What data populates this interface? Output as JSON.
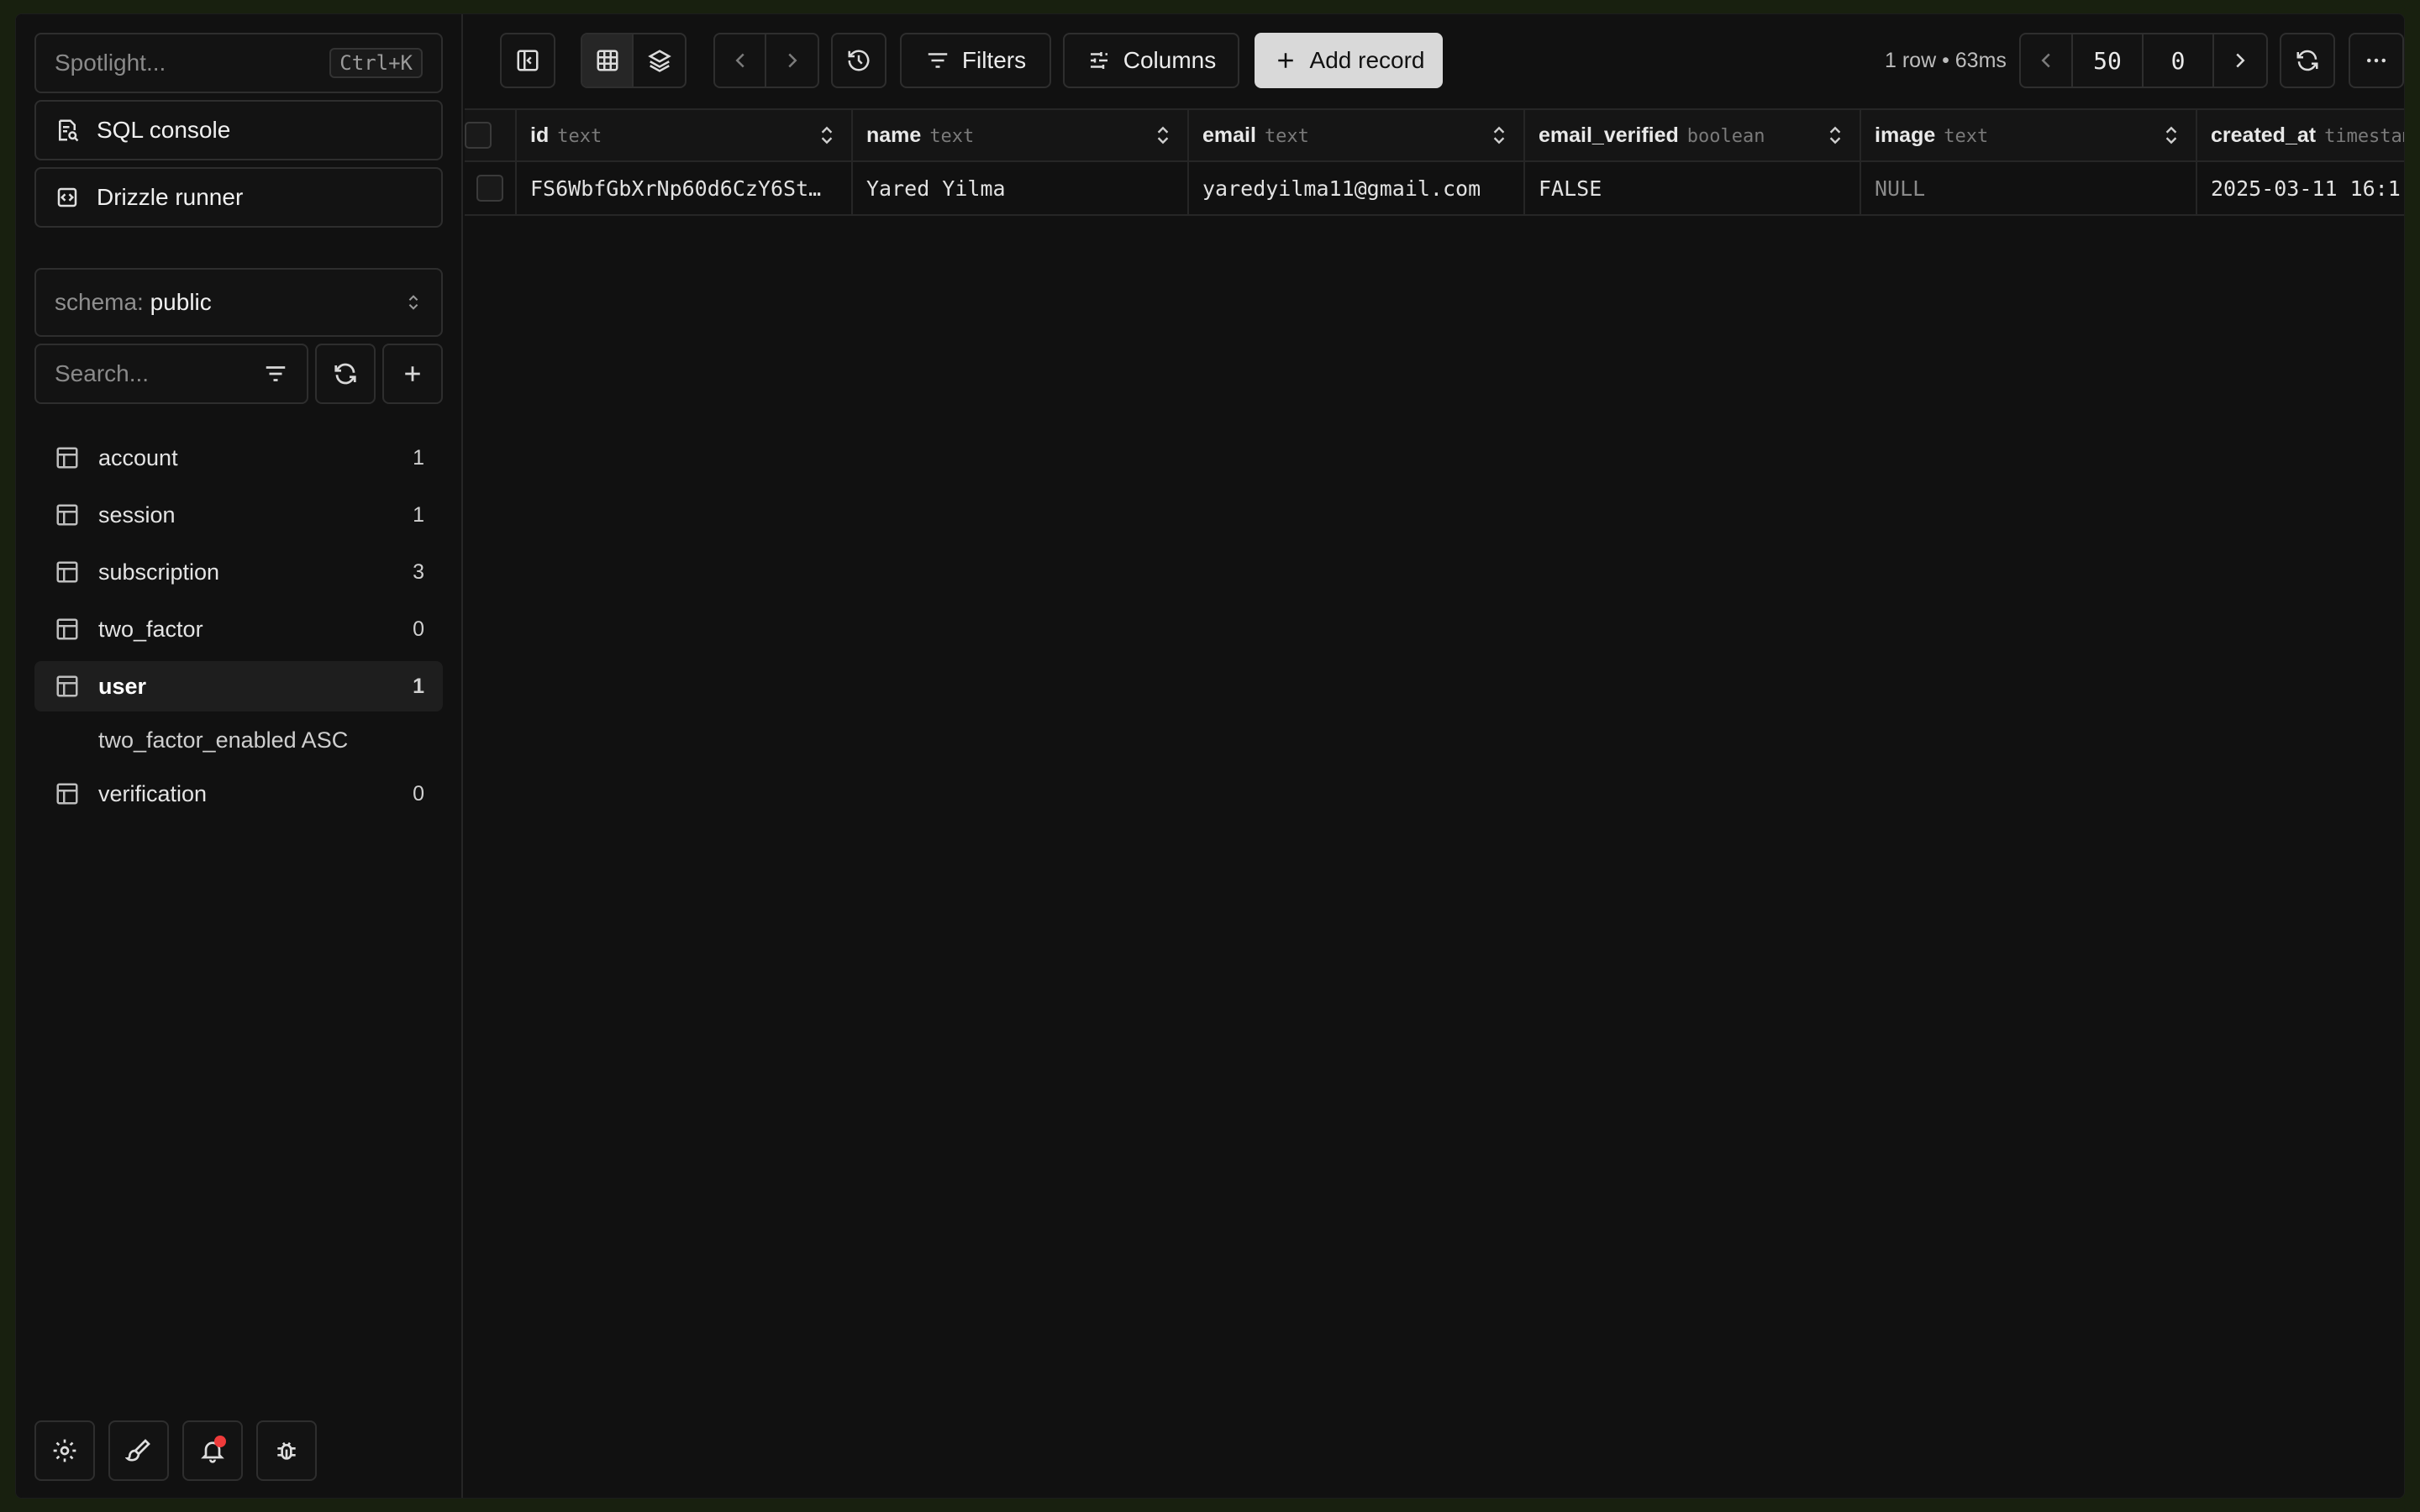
{
  "sidebar": {
    "spotlight": {
      "placeholder": "Spotlight...",
      "shortcut": "Ctrl+K"
    },
    "sql_console": "SQL console",
    "drizzle_runner": "Drizzle runner",
    "schema": {
      "label": "schema:",
      "value": "public"
    },
    "search": {
      "placeholder": "Search..."
    },
    "tables": [
      {
        "name": "account",
        "count": "1"
      },
      {
        "name": "session",
        "count": "1"
      },
      {
        "name": "subscription",
        "count": "3"
      },
      {
        "name": "two_factor",
        "count": "0"
      },
      {
        "name": "user",
        "count": "1",
        "active": true
      },
      {
        "name": "verification",
        "count": "0"
      }
    ],
    "active_sort": "two_factor_enabled ASC",
    "bottom_icons": [
      "gear-icon",
      "brush-icon",
      "bell-icon",
      "bug-icon"
    ]
  },
  "toolbar": {
    "filters_label": "Filters",
    "columns_label": "Columns",
    "add_record_label": "Add record",
    "row_info": "1 row • 63ms",
    "page_size": "50",
    "page_offset": "0"
  },
  "grid": {
    "columns": [
      {
        "name": "id",
        "type": "text"
      },
      {
        "name": "name",
        "type": "text"
      },
      {
        "name": "email",
        "type": "text"
      },
      {
        "name": "email_verified",
        "type": "boolean"
      },
      {
        "name": "image",
        "type": "text"
      },
      {
        "name": "created_at",
        "type": "timestamp"
      }
    ],
    "rows": [
      [
        "FS6WbfGbXrNp60d6CzY6St…",
        "Yared Yilma",
        "yaredyilma11@gmail.com",
        "FALSE",
        "NULL",
        "2025-03-11 16:1"
      ]
    ]
  }
}
